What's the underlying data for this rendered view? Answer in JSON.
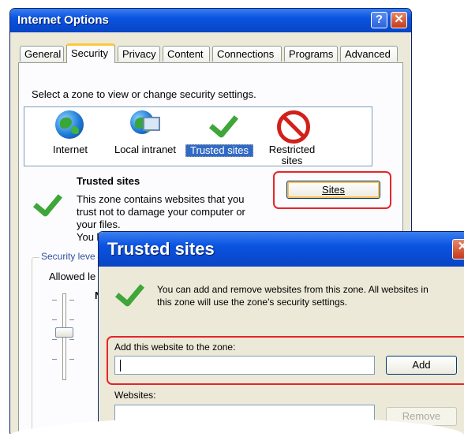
{
  "window": {
    "title": "Internet Options",
    "help_glyph": "?",
    "close_glyph": "✕",
    "tabs": [
      "General",
      "Security",
      "Privacy",
      "Content",
      "Connections",
      "Programs",
      "Advanced"
    ],
    "active_tab": "Security"
  },
  "security": {
    "prompt": "Select a zone to view or change security settings.",
    "zones": [
      {
        "label": "Internet",
        "icon": "globe-icon"
      },
      {
        "label": "Local intranet",
        "icon": "intranet-icon"
      },
      {
        "label": "Trusted sites",
        "icon": "checkmark-icon",
        "selected": true
      },
      {
        "label": "Restricted sites",
        "icon": "restricted-icon"
      }
    ],
    "zone_heading": "Trusted sites",
    "zone_desc_1": "This zone contains websites that you",
    "zone_desc_2": "trust not to damage your computer or",
    "zone_desc_3": "your files.",
    "zone_desc_4": "You l",
    "sites_button": "Sites",
    "security_level_group": "Security leve",
    "allowed_levels": "Allowed le",
    "partial_letter": "N"
  },
  "dialog": {
    "title": "Trusted sites",
    "close_glyph": "✕",
    "info_1": "You can add and remove websites from this zone. All websites in",
    "info_2": "this zone will use the zone's security settings.",
    "add_label": "Add this website to the zone:",
    "add_input_value": "",
    "add_button": "Add",
    "websites_label": "Websites:",
    "remove_button": "Remove"
  },
  "colors": {
    "titlebar": "#0a53e0",
    "dialog_bg": "#ece9d8",
    "highlight": "#e5252a",
    "selection": "#316ac5"
  }
}
